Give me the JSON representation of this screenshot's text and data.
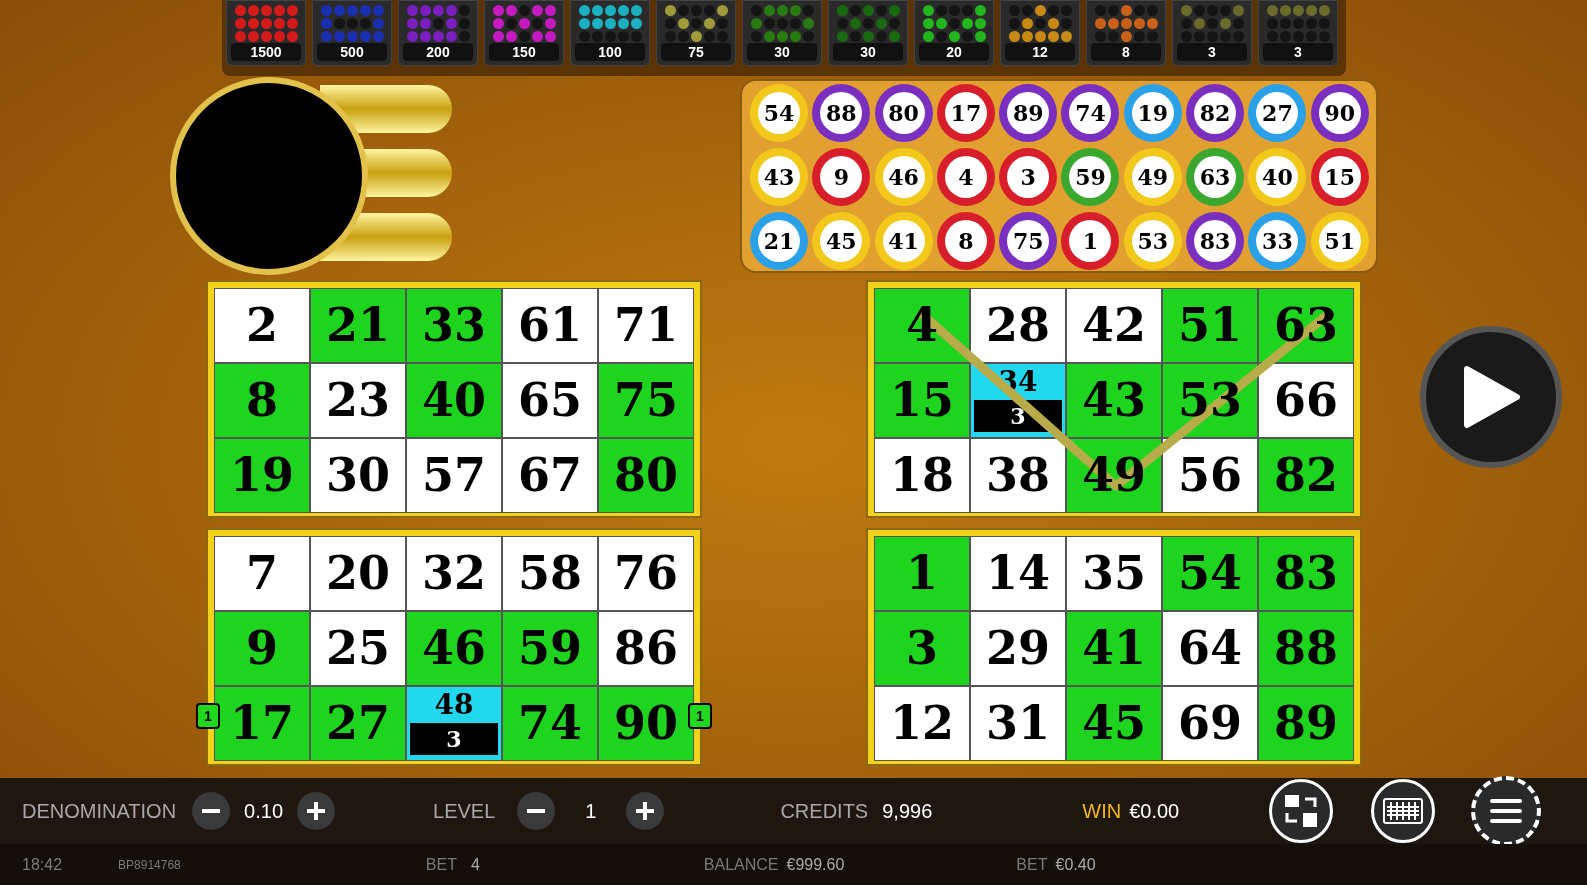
{
  "paytable": [
    {
      "payout": "1500",
      "color": "#d41a1a",
      "lit": [
        [
          true,
          true,
          true,
          true,
          true
        ],
        [
          true,
          true,
          true,
          true,
          true
        ],
        [
          true,
          true,
          true,
          true,
          true
        ]
      ]
    },
    {
      "payout": "500",
      "color": "#1a2fb0",
      "lit": [
        [
          true,
          true,
          true,
          true,
          true
        ],
        [
          true,
          false,
          false,
          false,
          true
        ],
        [
          true,
          true,
          true,
          true,
          true
        ]
      ]
    },
    {
      "payout": "200",
      "color": "#7a1ec0",
      "lit": [
        [
          true,
          true,
          true,
          true,
          false
        ],
        [
          true,
          true,
          false,
          true,
          false
        ],
        [
          true,
          true,
          true,
          true,
          false
        ]
      ]
    },
    {
      "payout": "150",
      "color": "#c41ac0",
      "lit": [
        [
          true,
          true,
          false,
          true,
          true
        ],
        [
          true,
          false,
          true,
          false,
          true
        ],
        [
          true,
          true,
          false,
          true,
          true
        ]
      ]
    },
    {
      "payout": "100",
      "color": "#1ab0c0",
      "lit": [
        [
          true,
          true,
          true,
          true,
          true
        ],
        [
          true,
          true,
          true,
          true,
          true
        ],
        [
          false,
          false,
          false,
          false,
          false
        ]
      ]
    },
    {
      "payout": "75",
      "color": "#a09a3a",
      "lit": [
        [
          true,
          false,
          false,
          false,
          true
        ],
        [
          false,
          true,
          false,
          true,
          false
        ],
        [
          false,
          false,
          true,
          false,
          false
        ]
      ]
    },
    {
      "payout": "30",
      "color": "#2a7a12",
      "lit": [
        [
          false,
          true,
          true,
          true,
          false
        ],
        [
          true,
          false,
          false,
          false,
          true
        ],
        [
          false,
          true,
          true,
          true,
          false
        ]
      ]
    },
    {
      "payout": "30",
      "color": "#1a6a12",
      "lit": [
        [
          true,
          false,
          true,
          false,
          true
        ],
        [
          false,
          true,
          false,
          true,
          false
        ],
        [
          true,
          false,
          true,
          false,
          true
        ]
      ]
    },
    {
      "payout": "20",
      "color": "#22b51e",
      "lit": [
        [
          true,
          false,
          false,
          false,
          true
        ],
        [
          true,
          true,
          false,
          true,
          true
        ],
        [
          true,
          false,
          true,
          false,
          true
        ]
      ]
    },
    {
      "payout": "12",
      "color": "#c88a12",
      "lit": [
        [
          false,
          false,
          true,
          false,
          false
        ],
        [
          false,
          true,
          false,
          true,
          false
        ],
        [
          true,
          true,
          true,
          true,
          true
        ]
      ]
    },
    {
      "payout": "8",
      "color": "#c8601a",
      "lit": [
        [
          false,
          false,
          true,
          false,
          false
        ],
        [
          true,
          true,
          true,
          true,
          true
        ],
        [
          false,
          false,
          true,
          false,
          false
        ]
      ]
    },
    {
      "payout": "3",
      "color": "#6a6a2a",
      "lit": [
        [
          true,
          false,
          false,
          false,
          true
        ],
        [
          false,
          true,
          false,
          true,
          false
        ],
        [
          false,
          false,
          false,
          false,
          false
        ]
      ]
    },
    {
      "payout": "3",
      "color": "#6a6a2a",
      "lit": [
        [
          true,
          true,
          true,
          true,
          true
        ],
        [
          false,
          false,
          false,
          false,
          false
        ],
        [
          false,
          false,
          false,
          false,
          false
        ]
      ]
    }
  ],
  "balls": [
    {
      "number": "54",
      "color": "#f2c81a"
    },
    {
      "number": "88",
      "color": "#7a2fc0"
    },
    {
      "number": "80",
      "color": "#7a2fc0"
    },
    {
      "number": "17",
      "color": "#d81e2a"
    },
    {
      "number": "89",
      "color": "#7a2fc0"
    },
    {
      "number": "74",
      "color": "#7a2fc0"
    },
    {
      "number": "19",
      "color": "#2aa0e8"
    },
    {
      "number": "82",
      "color": "#7a2fc0"
    },
    {
      "number": "27",
      "color": "#2aa0e8"
    },
    {
      "number": "90",
      "color": "#7a2fc0"
    },
    {
      "number": "43",
      "color": "#f2c81a"
    },
    {
      "number": "9",
      "color": "#d81e2a"
    },
    {
      "number": "46",
      "color": "#f2c81a"
    },
    {
      "number": "4",
      "color": "#d81e2a"
    },
    {
      "number": "3",
      "color": "#d81e2a"
    },
    {
      "number": "59",
      "color": "#3aa82e"
    },
    {
      "number": "49",
      "color": "#f2c81a"
    },
    {
      "number": "63",
      "color": "#3aa82e"
    },
    {
      "number": "40",
      "color": "#f2c81a"
    },
    {
      "number": "15",
      "color": "#d81e2a"
    },
    {
      "number": "21",
      "color": "#2aa0e8"
    },
    {
      "number": "45",
      "color": "#f2c81a"
    },
    {
      "number": "41",
      "color": "#f2c81a"
    },
    {
      "number": "8",
      "color": "#d81e2a"
    },
    {
      "number": "75",
      "color": "#7a2fc0"
    },
    {
      "number": "1",
      "color": "#d81e2a"
    },
    {
      "number": "53",
      "color": "#f2c81a"
    },
    {
      "number": "83",
      "color": "#7a2fc0"
    },
    {
      "number": "33",
      "color": "#2aa0e8"
    },
    {
      "number": "51",
      "color": "#f2c81a"
    }
  ],
  "cards": [
    {
      "cells": [
        {
          "number": "2",
          "kind": "plain"
        },
        {
          "number": "21",
          "kind": "marked"
        },
        {
          "number": "33",
          "kind": "marked"
        },
        {
          "number": "61",
          "kind": "plain"
        },
        {
          "number": "71",
          "kind": "plain"
        },
        {
          "number": "8",
          "kind": "marked"
        },
        {
          "number": "23",
          "kind": "plain"
        },
        {
          "number": "40",
          "kind": "marked"
        },
        {
          "number": "65",
          "kind": "plain"
        },
        {
          "number": "75",
          "kind": "marked"
        },
        {
          "number": "19",
          "kind": "marked"
        },
        {
          "number": "30",
          "kind": "plain"
        },
        {
          "number": "57",
          "kind": "plain"
        },
        {
          "number": "67",
          "kind": "plain"
        },
        {
          "number": "80",
          "kind": "marked"
        }
      ]
    },
    {
      "win_line": true,
      "cells": [
        {
          "number": "4",
          "kind": "marked"
        },
        {
          "number": "28",
          "kind": "plain"
        },
        {
          "number": "42",
          "kind": "plain"
        },
        {
          "number": "51",
          "kind": "marked"
        },
        {
          "number": "63",
          "kind": "marked"
        },
        {
          "number": "15",
          "kind": "marked"
        },
        {
          "number": "34",
          "kind": "near",
          "need": "3"
        },
        {
          "number": "43",
          "kind": "marked"
        },
        {
          "number": "53",
          "kind": "marked"
        },
        {
          "number": "66",
          "kind": "plain"
        },
        {
          "number": "18",
          "kind": "plain"
        },
        {
          "number": "38",
          "kind": "plain"
        },
        {
          "number": "49",
          "kind": "marked"
        },
        {
          "number": "56",
          "kind": "plain"
        },
        {
          "number": "82",
          "kind": "marked"
        }
      ]
    },
    {
      "line_markers": [
        "1",
        "1"
      ],
      "cells": [
        {
          "number": "7",
          "kind": "plain"
        },
        {
          "number": "20",
          "kind": "plain"
        },
        {
          "number": "32",
          "kind": "plain"
        },
        {
          "number": "58",
          "kind": "plain"
        },
        {
          "number": "76",
          "kind": "plain"
        },
        {
          "number": "9",
          "kind": "marked"
        },
        {
          "number": "25",
          "kind": "plain"
        },
        {
          "number": "46",
          "kind": "marked"
        },
        {
          "number": "59",
          "kind": "marked"
        },
        {
          "number": "86",
          "kind": "plain"
        },
        {
          "number": "17",
          "kind": "marked"
        },
        {
          "number": "27",
          "kind": "marked"
        },
        {
          "number": "48",
          "kind": "near",
          "need": "3"
        },
        {
          "number": "74",
          "kind": "marked"
        },
        {
          "number": "90",
          "kind": "marked"
        }
      ]
    },
    {
      "cells": [
        {
          "number": "1",
          "kind": "marked"
        },
        {
          "number": "14",
          "kind": "plain"
        },
        {
          "number": "35",
          "kind": "plain"
        },
        {
          "number": "54",
          "kind": "marked"
        },
        {
          "number": "83",
          "kind": "marked"
        },
        {
          "number": "3",
          "kind": "marked"
        },
        {
          "number": "29",
          "kind": "plain"
        },
        {
          "number": "41",
          "kind": "marked"
        },
        {
          "number": "64",
          "kind": "plain"
        },
        {
          "number": "88",
          "kind": "marked"
        },
        {
          "number": "12",
          "kind": "plain"
        },
        {
          "number": "31",
          "kind": "plain"
        },
        {
          "number": "45",
          "kind": "marked"
        },
        {
          "number": "69",
          "kind": "plain"
        },
        {
          "number": "89",
          "kind": "marked"
        }
      ]
    }
  ],
  "controls": {
    "denomination": {
      "label": "DENOMINATION",
      "value": "0.10"
    },
    "level": {
      "label": "LEVEL",
      "value": "1"
    },
    "credits": {
      "label": "CREDITS",
      "value": "9,996"
    },
    "win": {
      "label": "WIN",
      "value": "€0.00"
    }
  },
  "status_bar": {
    "time": "18:42",
    "session": "BP8914768",
    "bet": {
      "label": "BET",
      "value": "4"
    },
    "balance": {
      "label": "BALANCE",
      "value": "€999.60"
    },
    "bet_amount": {
      "label": "BET",
      "value": "€0.40"
    }
  }
}
